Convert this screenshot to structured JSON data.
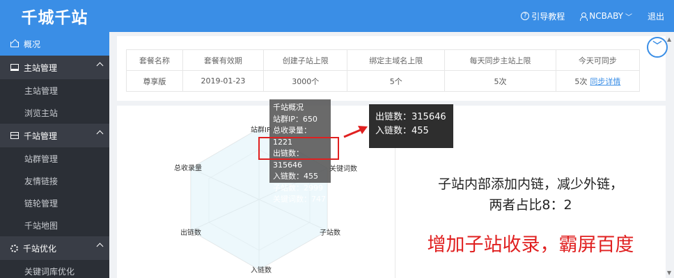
{
  "header": {
    "logo": "千城千站",
    "guide_label": "引导教程",
    "user_label": "NCBABY",
    "logout_label": "退出"
  },
  "sidebar": {
    "overview": "概况",
    "groups": [
      {
        "label": "主站管理",
        "items": [
          "主站管理",
          "浏览主站"
        ]
      },
      {
        "label": "千站管理",
        "items": [
          "站群管理",
          "友情链接",
          "链轮管理",
          "千站地图"
        ]
      },
      {
        "label": "千站优化",
        "items": [
          "关键词库优化"
        ]
      }
    ]
  },
  "package_table": {
    "headers": [
      "套餐名称",
      "套餐有效期",
      "创建子站上限",
      "绑定主域名上限",
      "每天同步主站上限",
      "今天可同步"
    ],
    "row": [
      "尊享版",
      "2019-01-23",
      "3000个",
      "5个",
      "5次",
      "5次"
    ],
    "link": "同步详情"
  },
  "radar": {
    "labels": [
      "站群IP",
      "关键词数",
      "子站数",
      "入链数",
      "出链数",
      "总收录量"
    ]
  },
  "tooltip": {
    "title": "千站概况",
    "lines": [
      "站群IP：650",
      "总收录量：1221",
      "出链数：315646",
      "入链数：455",
      "子站数：2999",
      "关键词数：747"
    ]
  },
  "callout": {
    "lines": [
      "出链数：315646",
      "入链数：455"
    ]
  },
  "note": {
    "line1": "子站内部添加内链，减少外链，",
    "line2": "两者占比8：2",
    "line3": "增加子站收录，霸屏百度"
  },
  "colors": {
    "primary": "#3a8ee6",
    "sidebar": "#2b2f36",
    "accent_red": "#e02020"
  }
}
